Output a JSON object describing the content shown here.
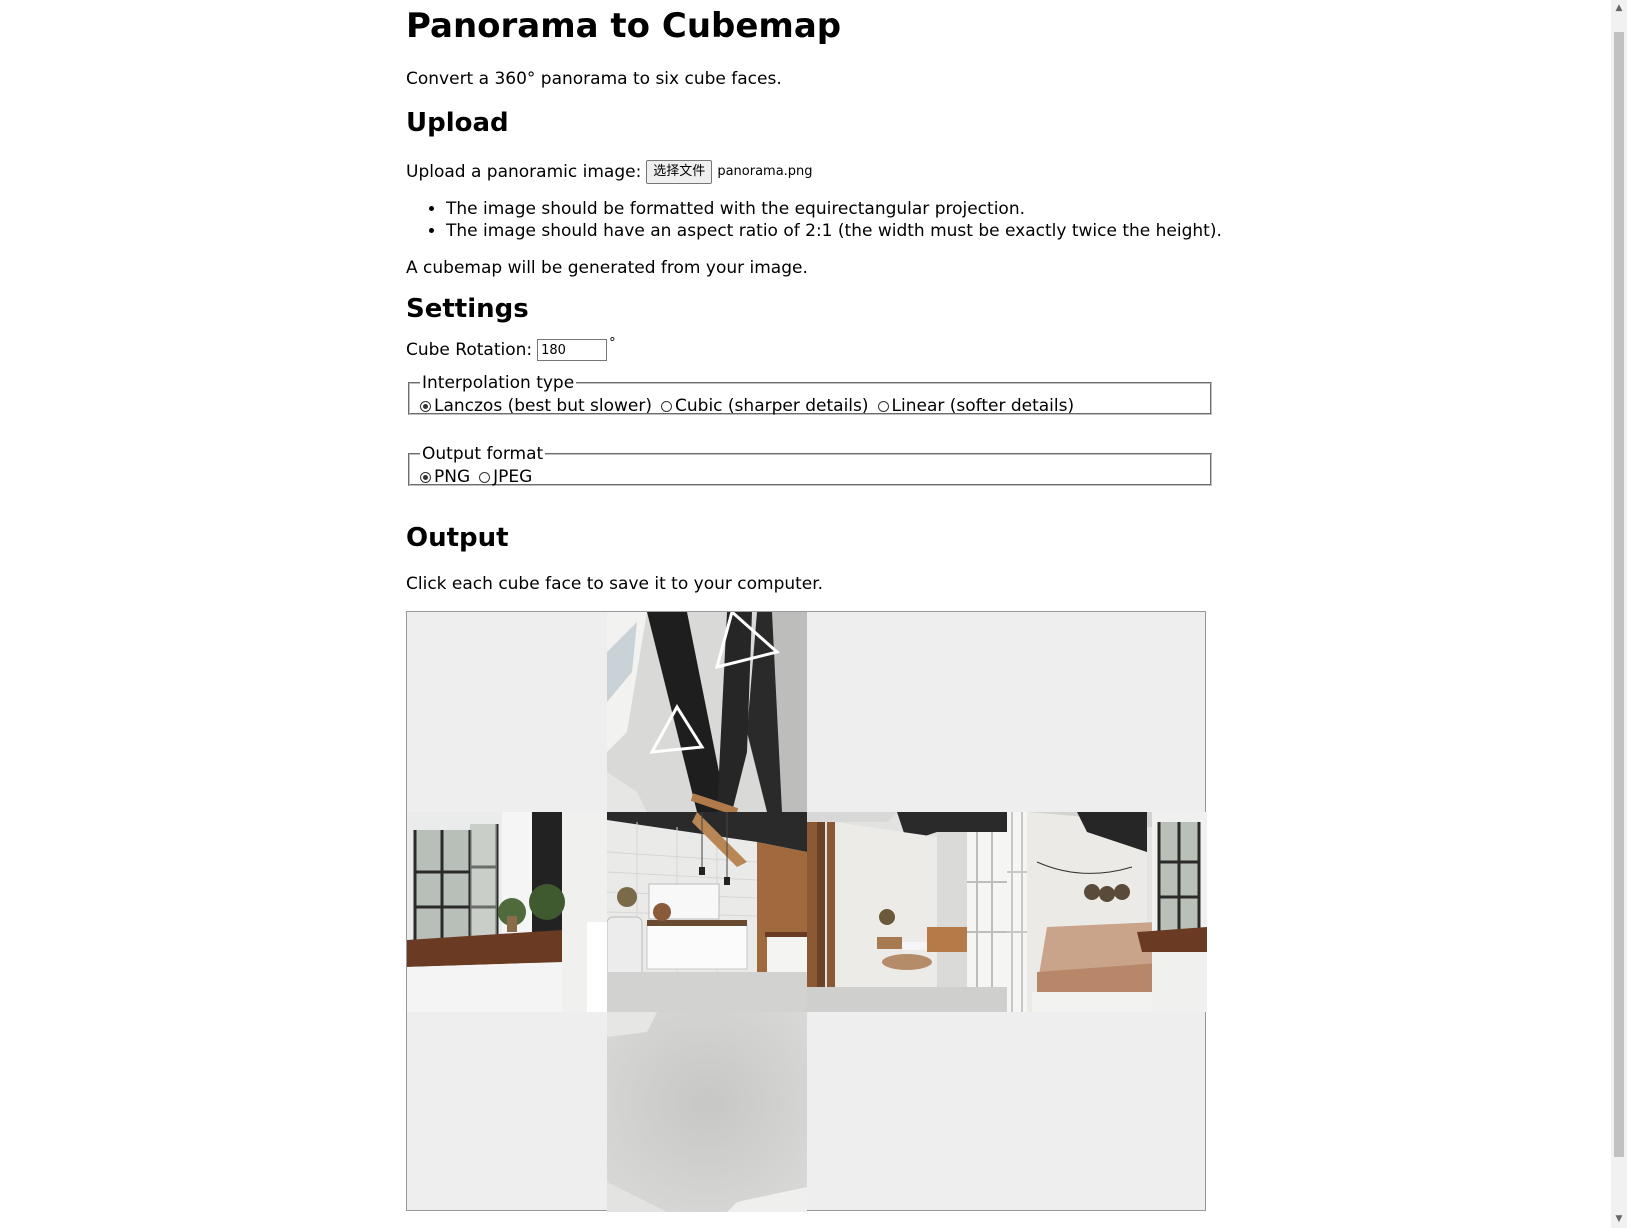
{
  "page": {
    "title": "Panorama to Cubemap",
    "intro": "Convert a 360° panorama to six cube faces."
  },
  "upload": {
    "heading": "Upload",
    "label": "Upload a panoramic image:",
    "button_label": "选择文件",
    "file_name": "panorama.png",
    "notes": [
      "The image should be formatted with the equirectangular projection.",
      "The image should have an aspect ratio of 2:1 (the width must be exactly twice the height)."
    ],
    "generated_note": "A cubemap will be generated from your image."
  },
  "settings": {
    "heading": "Settings",
    "rotation_label": "Cube Rotation:",
    "rotation_value": "180",
    "rotation_unit": "°",
    "interpolation": {
      "legend": "Interpolation type",
      "options": [
        "Lanczos (best but slower)",
        "Cubic (sharper details)",
        "Linear (softer details)"
      ],
      "selected": "Lanczos (best but slower)"
    },
    "output_format": {
      "legend": "Output format",
      "options": [
        "PNG",
        "JPEG"
      ],
      "selected": "PNG"
    }
  },
  "output": {
    "heading": "Output",
    "instructions": "Click each cube face to save it to your computer.",
    "faces": [
      "top",
      "left",
      "front",
      "right",
      "back",
      "bottom"
    ]
  },
  "colors": {
    "cube_background": "#eeeeee",
    "wall_white": "#e8e8e6",
    "beam_black": "#1e1e1e",
    "wood": "#8b5a35",
    "floor_gray": "#cfcfcd"
  }
}
